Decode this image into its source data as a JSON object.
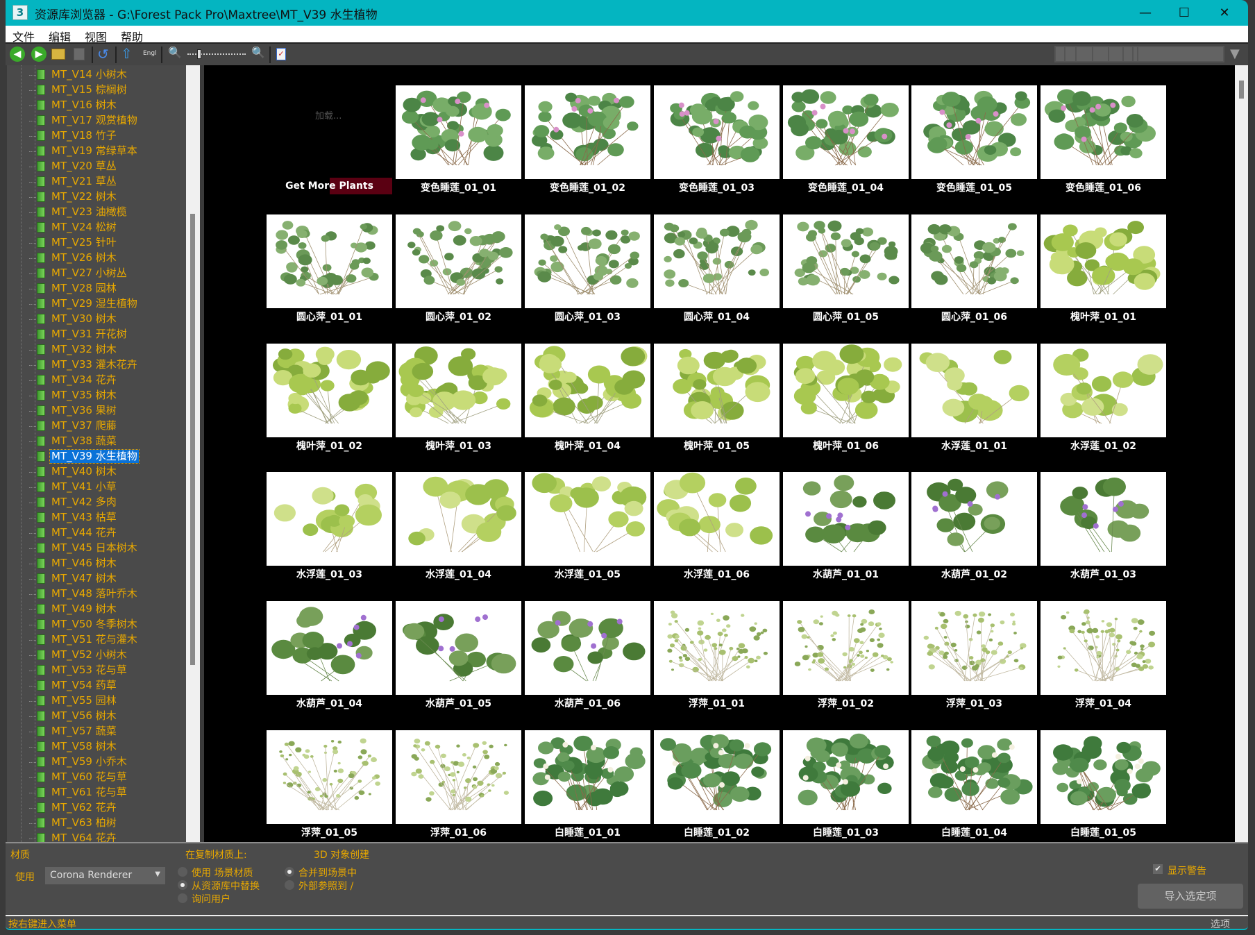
{
  "window": {
    "icon_label": "3",
    "title": "资源库浏览器 - G:\\Forest Pack Pro\\Maxtree\\MT_V39 水生植物",
    "minimize": "—",
    "maximize": "☐",
    "close": "✕"
  },
  "menu": [
    "文件",
    "编辑",
    "视图",
    "帮助"
  ],
  "toolbar": {
    "language": "Engl",
    "zoom_level": 0.2
  },
  "tree": {
    "selected_index": 25,
    "items": [
      "MT_V14 小树木",
      "MT_V15 棕榈树",
      "MT_V16 树木",
      "MT_V17 观赏植物",
      "MT_V18 竹子",
      "MT_V19 常绿草本",
      "MT_V20 草丛",
      "MT_V21 草丛",
      "MT_V22 树木",
      "MT_V23 油橄榄",
      "MT_V24 松树",
      "MT_V25 针叶",
      "MT_V26 树木",
      "MT_V27 小树丛",
      "MT_V28 园林",
      "MT_V29 湿生植物",
      "MT_V30 树木",
      "MT_V31 开花树",
      "MT_V32 树木",
      "MT_V33 灌木花卉",
      "MT_V34 花卉",
      "MT_V35 树木",
      "MT_V36 果树",
      "MT_V37 爬藤",
      "MT_V38 蔬菜",
      "MT_V39 水生植物",
      "MT_V40 树木",
      "MT_V41 小草",
      "MT_V42 多肉",
      "MT_V43 枯草",
      "MT_V44 花卉",
      "MT_V45 日本树木",
      "MT_V46 树木",
      "MT_V47 树木",
      "MT_V48 落叶乔木",
      "MT_V49 树木",
      "MT_V50 冬季树木",
      "MT_V51 花与灌木",
      "MT_V52 小树木",
      "MT_V53 花与草",
      "MT_V54 药草",
      "MT_V55 园林",
      "MT_V56 树木",
      "MT_V57 蔬菜",
      "MT_V58 树木",
      "MT_V59 小乔木",
      "MT_V60 花与草",
      "MT_V61 花与草",
      "MT_V62 花卉",
      "MT_V63 柏树",
      "MT_V64 花卉"
    ]
  },
  "grid": {
    "loading": "加载...",
    "get_more": "Get More Plants",
    "items": [
      {
        "label": "变色睡莲_01_01",
        "kind": "lotus"
      },
      {
        "label": "变色睡莲_01_02",
        "kind": "lotus"
      },
      {
        "label": "变色睡莲_01_03",
        "kind": "lotus"
      },
      {
        "label": "变色睡莲_01_04",
        "kind": "lotus"
      },
      {
        "label": "变色睡莲_01_05",
        "kind": "lotus"
      },
      {
        "label": "变色睡莲_01_06",
        "kind": "lotus"
      },
      {
        "label": "圆心萍_01_01",
        "kind": "pennywort"
      },
      {
        "label": "圆心萍_01_02",
        "kind": "pennywort"
      },
      {
        "label": "圆心萍_01_03",
        "kind": "pennywort"
      },
      {
        "label": "圆心萍_01_04",
        "kind": "pennywort"
      },
      {
        "label": "圆心萍_01_05",
        "kind": "pennywort"
      },
      {
        "label": "圆心萍_01_06",
        "kind": "pennywort"
      },
      {
        "label": "槐叶萍_01_01",
        "kind": "salvinia"
      },
      {
        "label": "槐叶萍_01_02",
        "kind": "salvinia"
      },
      {
        "label": "槐叶萍_01_03",
        "kind": "salvinia"
      },
      {
        "label": "槐叶萍_01_04",
        "kind": "salvinia"
      },
      {
        "label": "槐叶萍_01_05",
        "kind": "salvinia"
      },
      {
        "label": "槐叶萍_01_06",
        "kind": "salvinia"
      },
      {
        "label": "水浮莲_01_01",
        "kind": "lettuce"
      },
      {
        "label": "水浮莲_01_02",
        "kind": "lettuce"
      },
      {
        "label": "水浮莲_01_03",
        "kind": "lettuce"
      },
      {
        "label": "水浮莲_01_04",
        "kind": "lettuce"
      },
      {
        "label": "水浮莲_01_05",
        "kind": "lettuce"
      },
      {
        "label": "水浮莲_01_06",
        "kind": "lettuce"
      },
      {
        "label": "水葫芦_01_01",
        "kind": "hyacinth"
      },
      {
        "label": "水葫芦_01_02",
        "kind": "hyacinth"
      },
      {
        "label": "水葫芦_01_03",
        "kind": "hyacinth"
      },
      {
        "label": "水葫芦_01_04",
        "kind": "hyacinth"
      },
      {
        "label": "水葫芦_01_05",
        "kind": "hyacinth"
      },
      {
        "label": "水葫芦_01_06",
        "kind": "hyacinth"
      },
      {
        "label": "浮萍_01_01",
        "kind": "duckweed"
      },
      {
        "label": "浮萍_01_02",
        "kind": "duckweed"
      },
      {
        "label": "浮萍_01_03",
        "kind": "duckweed"
      },
      {
        "label": "浮萍_01_04",
        "kind": "duckweed"
      },
      {
        "label": "浮萍_01_05",
        "kind": "duckweed"
      },
      {
        "label": "浮萍_01_06",
        "kind": "duckweed"
      },
      {
        "label": "白睡莲_01_01",
        "kind": "whitelily"
      },
      {
        "label": "白睡莲_01_02",
        "kind": "whitelily"
      },
      {
        "label": "白睡莲_01_03",
        "kind": "whitelily"
      },
      {
        "label": "白睡莲_01_04",
        "kind": "whitelily"
      },
      {
        "label": "白睡莲_01_05",
        "kind": "whitelily"
      }
    ]
  },
  "bottom": {
    "material_title": "材质",
    "use_label": "使用",
    "renderer": "Corona Renderer",
    "on_copy_title": "在复制材质上:",
    "copy_options": [
      "使用 场景材质",
      "从资源库中替换",
      "询问用户"
    ],
    "copy_selected": 1,
    "create_title": "3D 对象创建",
    "create_options": [
      "合并到场景中",
      "外部参照到 /"
    ],
    "create_selected": 0,
    "show_warnings": "显示警告",
    "show_warnings_checked": true,
    "import_button": "导入选定项"
  },
  "status": {
    "hint": "按右键进入菜单",
    "options": "选项"
  },
  "colors": {
    "accent": "#04b5c1",
    "tree_text": "#e8a800",
    "selection": "#0a72d8"
  }
}
